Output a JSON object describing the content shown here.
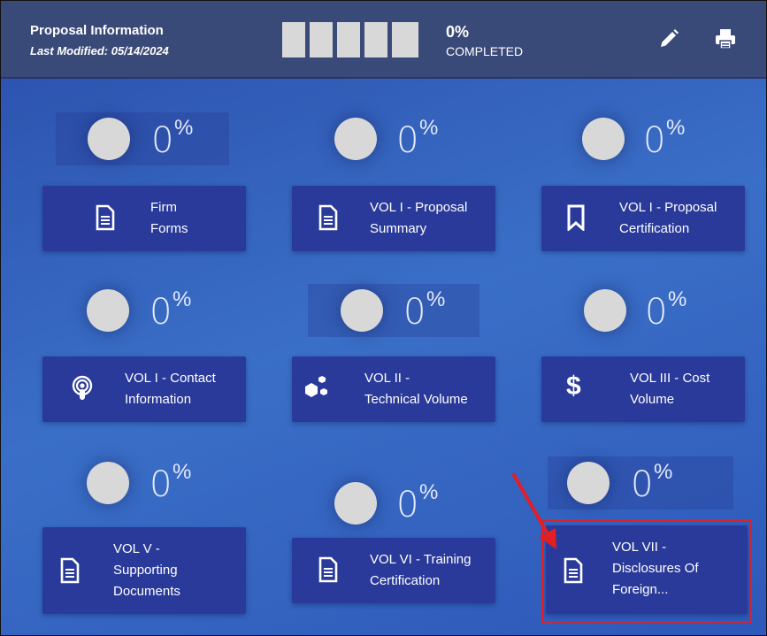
{
  "header": {
    "title": "Proposal Information",
    "last_modified": "Last Modified: 05/14/2024",
    "progress_percent": "0%",
    "progress_label": "COMPLETED",
    "progress_fraction": 0
  },
  "gauges": [
    {
      "value": "0",
      "unit": "%"
    },
    {
      "value": "0",
      "unit": "%"
    },
    {
      "value": "0",
      "unit": "%"
    },
    {
      "value": "0",
      "unit": "%"
    },
    {
      "value": "0",
      "unit": "%"
    },
    {
      "value": "0",
      "unit": "%"
    },
    {
      "value": "0",
      "unit": "%"
    },
    {
      "value": "0",
      "unit": "%"
    },
    {
      "value": "0",
      "unit": "%"
    }
  ],
  "cards": [
    {
      "line1": "Firm",
      "line2": "Forms",
      "line3": "",
      "icon": "document-icon"
    },
    {
      "line1": "VOL I - Proposal",
      "line2": "Summary",
      "line3": "",
      "icon": "document-icon"
    },
    {
      "line1": "VOL I - Proposal",
      "line2": "Certification",
      "line3": "",
      "icon": "bookmark-icon"
    },
    {
      "line1": "VOL I - Contact",
      "line2": "Information",
      "line3": "",
      "icon": "podcast-icon"
    },
    {
      "line1": "VOL II -",
      "line2": "Technical Volume",
      "line3": "",
      "icon": "cubes-icon"
    },
    {
      "line1": "VOL III - Cost",
      "line2": "Volume",
      "line3": "",
      "icon": "dollar-icon"
    },
    {
      "line1": "VOL V -",
      "line2": "Supporting",
      "line3": "Documents",
      "icon": "document-icon"
    },
    {
      "line1": "VOL VI - Training",
      "line2": "Certification",
      "line3": "",
      "icon": "document-icon"
    },
    {
      "line1": "VOL VII -",
      "line2": "Disclosures Of",
      "line3": "Foreign...",
      "icon": "document-icon"
    }
  ],
  "colors": {
    "header_bg": "#3a4a78",
    "card_bg": "#2a3a9a",
    "highlight": "#e31e24"
  }
}
